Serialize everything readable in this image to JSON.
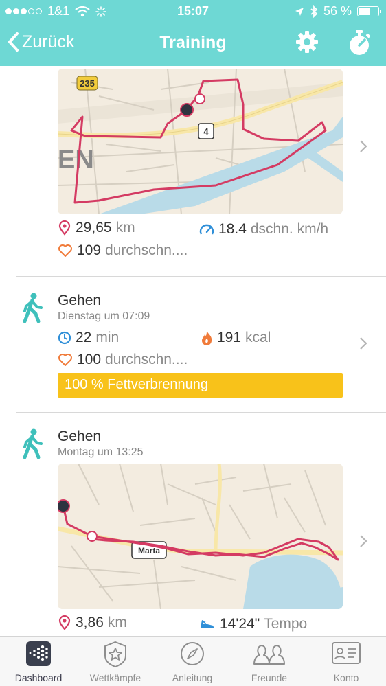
{
  "status_bar": {
    "carrier": "1&1",
    "time": "15:07",
    "battery": "56 %",
    "battery_level": 0.56
  },
  "nav": {
    "back_label": "Zurück",
    "title": "Training"
  },
  "activities": [
    {
      "map": {
        "labels": [
          "235",
          "4",
          "EN"
        ]
      },
      "distance_value": "29,65",
      "distance_unit": "km",
      "speed_value": "18.4",
      "speed_unit": "dschn. km/h",
      "heart_value": "109",
      "heart_unit": "durchschn...."
    },
    {
      "name": "Gehen",
      "date": "Dienstag um 07:09",
      "duration_value": "22",
      "duration_unit": "min",
      "calories_value": "191",
      "calories_unit": "kcal",
      "heart_value": "100",
      "heart_unit": "durchschn....",
      "zone_badge": "100 % Fettverbrennung"
    },
    {
      "name": "Gehen",
      "date": "Montag um 13:25",
      "map": {
        "labels": [
          "Marta"
        ]
      },
      "distance_value": "3,86",
      "distance_unit": "km",
      "pace_value": "14'24\"",
      "pace_unit": "Tempo"
    }
  ],
  "tabs": [
    {
      "label": "Dashboard",
      "icon": "dashboard-icon",
      "active": true
    },
    {
      "label": "Wettkämpfe",
      "icon": "star-badge-icon"
    },
    {
      "label": "Anleitung",
      "icon": "compass-icon"
    },
    {
      "label": "Freunde",
      "icon": "friends-icon"
    },
    {
      "label": "Konto",
      "icon": "account-card-icon"
    }
  ],
  "colors": {
    "header": "#6ed8d4",
    "route": "#d43b63",
    "badge": "#f8c21a",
    "walk_icon": "#3fc0bb"
  }
}
